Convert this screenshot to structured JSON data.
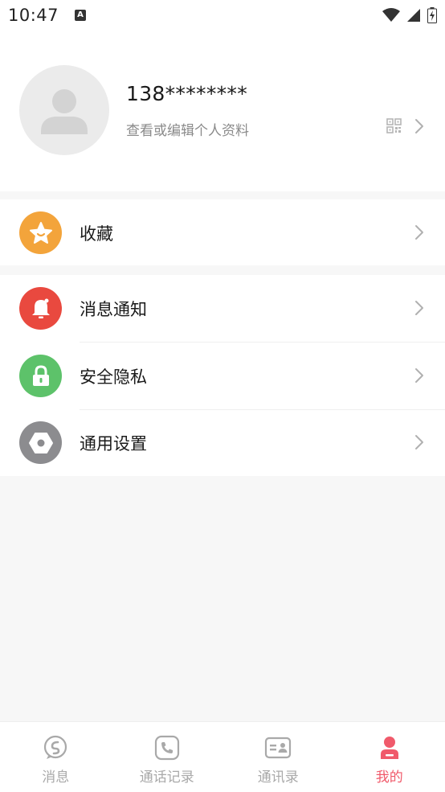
{
  "status_bar": {
    "time": "10:47",
    "notification_icon": "a-icon",
    "icons": [
      "wifi-icon",
      "signal-icon",
      "battery-icon"
    ]
  },
  "profile": {
    "phone": "138********",
    "subtitle": "查看或编辑个人资料",
    "avatar_icon": "person-icon",
    "qr_icon": "qr-code-icon",
    "chevron_icon": "chevron-right-icon"
  },
  "menu": {
    "favorites": {
      "label": "收藏",
      "icon": "star-icon",
      "color": "#f3a43b"
    },
    "notifications": {
      "label": "消息通知",
      "icon": "bell-icon",
      "color": "#e9493f"
    },
    "privacy": {
      "label": "安全隐私",
      "icon": "lock-icon",
      "color": "#5dc26a"
    },
    "settings": {
      "label": "通用设置",
      "icon": "hexagon-settings-icon",
      "color": "#8c8c8f"
    }
  },
  "tabbar": {
    "tabs": [
      {
        "label": "消息",
        "icon": "message-icon",
        "active": false
      },
      {
        "label": "通话记录",
        "icon": "phone-icon",
        "active": false
      },
      {
        "label": "通讯录",
        "icon": "contacts-icon",
        "active": false
      },
      {
        "label": "我的",
        "icon": "person-icon",
        "active": true
      }
    ],
    "active_color": "#f05a6b",
    "inactive_color": "#a9a9a9"
  }
}
